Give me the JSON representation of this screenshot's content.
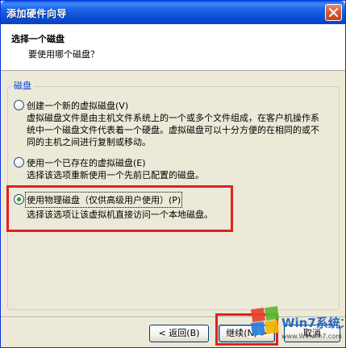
{
  "window": {
    "title": "添加硬件向导",
    "close_icon": "close-icon"
  },
  "header": {
    "title": "选择一个磁盘",
    "subtitle": "要使用哪个磁盘？"
  },
  "group": {
    "legend": "磁盘",
    "options": [
      {
        "label": "创建一个新的虚拟磁盘(V)",
        "description": "虚拟磁盘文件是由主机文件系统上的一个或多个文件组成，在客户机操作系统中一个磁盘文件代表着一个硬盘。虚拟磁盘可以十分方便的在相同的或不同的主机之间进行复制或移动。",
        "checked": false
      },
      {
        "label": "使用一个已存在的虚拟磁盘(E)",
        "description": "选择该选项重新使用一个先前已配置的磁盘。",
        "checked": false
      },
      {
        "label": "使用物理磁盘（仅供高级用户使用）(P)",
        "description": "选择该选项让该虚拟机直接访问一个本地磁盘。",
        "checked": true
      }
    ]
  },
  "buttons": {
    "back": "< 返回(B)",
    "next": "继续(N) >",
    "cancel": "取消"
  },
  "watermark": {
    "brand": "Win7系统之家",
    "url": "www.Winwin7.com"
  },
  "colors": {
    "titlebar": "#0a50d6",
    "highlight": "#e02020",
    "legend": "#0046d5"
  }
}
